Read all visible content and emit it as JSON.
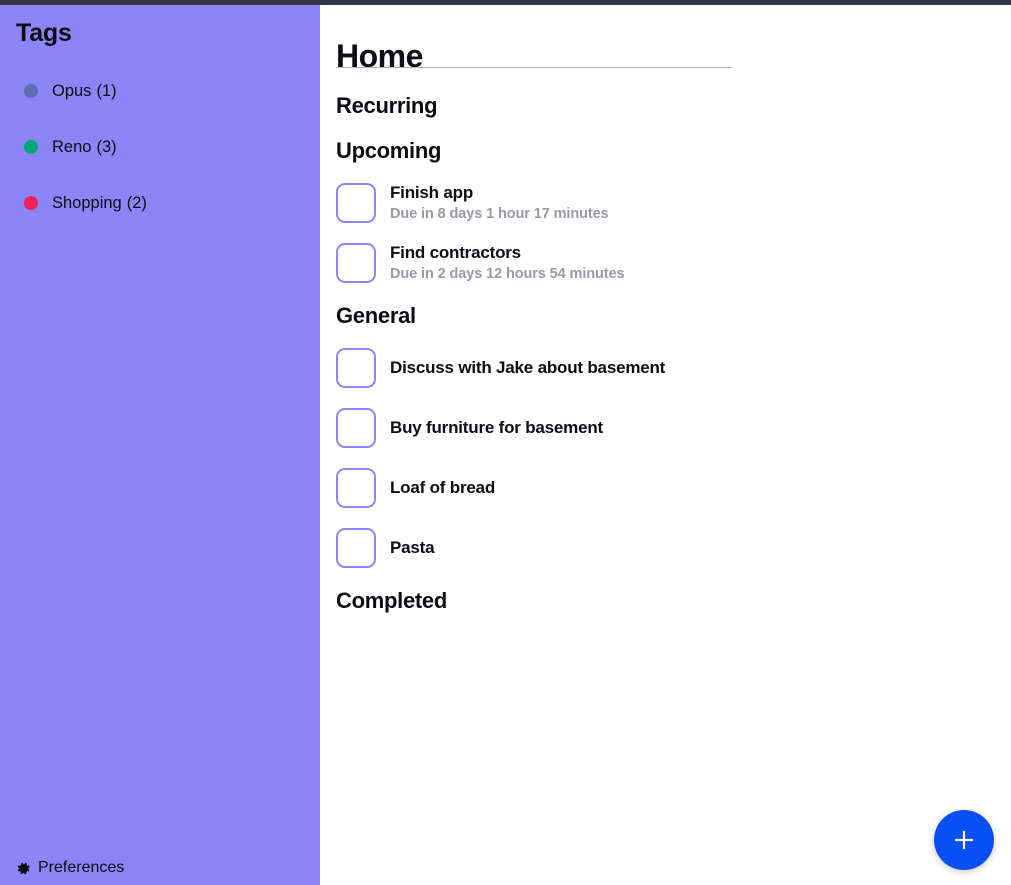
{
  "window": {
    "titlebar_color": "#323645"
  },
  "sidebar": {
    "title": "Tags",
    "background_color": "#8b85f8",
    "tags": [
      {
        "name": "Opus",
        "count": "(1)",
        "color": "#5d6cb0"
      },
      {
        "name": "Reno",
        "count": "(3)",
        "color": "#00a878"
      },
      {
        "name": "Shopping",
        "count": "(2)",
        "color": "#f0225c"
      }
    ],
    "preferences": {
      "label": "Preferences",
      "icon": "gear-icon"
    }
  },
  "main": {
    "page_title": "Home",
    "sections": [
      {
        "heading": "Recurring",
        "tasks": []
      },
      {
        "heading": "Upcoming",
        "tasks": [
          {
            "title": "Finish app",
            "due": "Due in 8 days 1 hour 17 minutes",
            "checked": false
          },
          {
            "title": "Find contractors",
            "due": "Due in 2 days 12 hours 54 minutes",
            "checked": false
          }
        ]
      },
      {
        "heading": "General",
        "tasks": [
          {
            "title": "Discuss with Jake about basement",
            "due": "",
            "checked": false
          },
          {
            "title": "Buy furniture for basement",
            "due": "",
            "checked": false
          },
          {
            "title": "Loaf of bread",
            "due": "",
            "checked": false
          },
          {
            "title": "Pasta",
            "due": "",
            "checked": false
          }
        ]
      },
      {
        "heading": "Completed",
        "tasks": []
      }
    ],
    "add_button": {
      "icon": "plus-icon",
      "color": "#0a4ff2"
    }
  }
}
